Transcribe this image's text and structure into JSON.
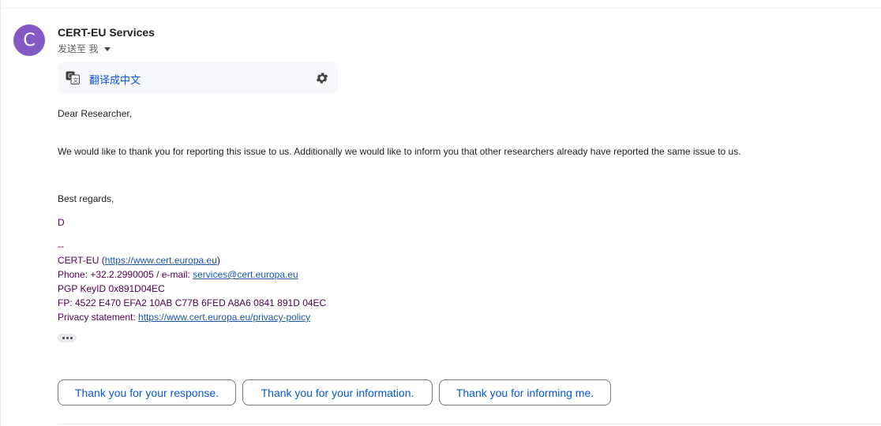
{
  "sender": {
    "initial": "C",
    "name": "CERT-EU Services",
    "recipient": "发送至 我"
  },
  "translate": {
    "label": "翻译成中文"
  },
  "message": {
    "greeting": "Dear Researcher,",
    "paragraph": "We would like to thank you for reporting this issue to us. Additionally we would like to inform you that other researchers already have reported the same issue to us.",
    "closing": "Best regards,",
    "initial": "D",
    "sig_separator": "--",
    "sig_org_prefix": "CERT-EU (",
    "sig_org_link": "https://www.cert.europa.eu",
    "sig_org_suffix": ")",
    "sig_phone_prefix": "Phone: +32.2.2990005 / e-mail: ",
    "sig_email": "services@cert.europa.eu",
    "sig_pgp": "PGP KeyID 0x891D04EC",
    "sig_fp": "FP: 4522 E470 EFA2 10AB C77B  6FED A8A6 0841 891D 04EC",
    "sig_privacy_prefix": "Privacy statement: ",
    "sig_privacy_link": "https://www.cert.europa.eu/privacy-policy"
  },
  "smart_replies": [
    "Thank you for your response.",
    "Thank you for your information.",
    "Thank you for informing me."
  ],
  "colors": {
    "avatar": "#8459c4",
    "link": "#0b57d0",
    "signature": "#500050"
  }
}
